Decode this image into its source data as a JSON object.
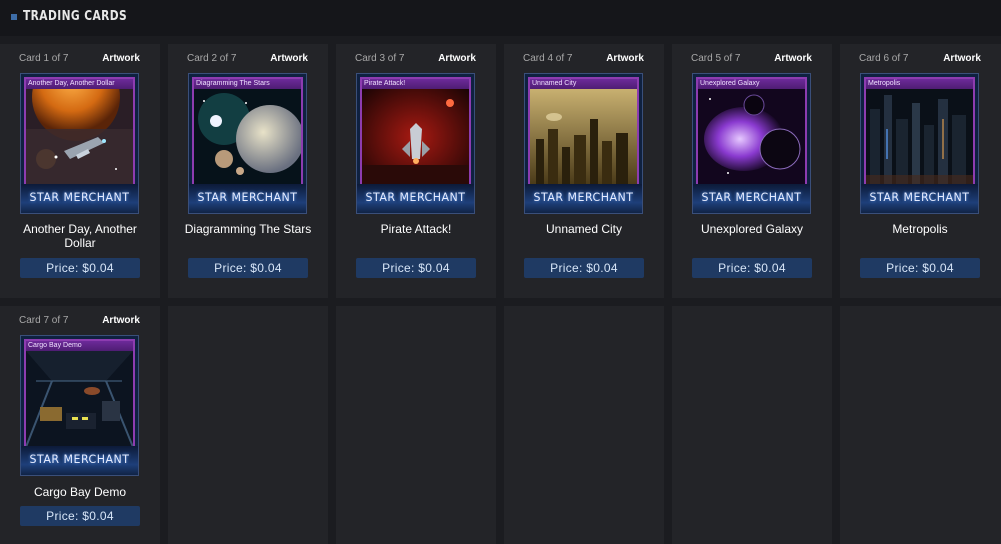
{
  "header": {
    "title": "Trading Cards"
  },
  "game_name": "STAR MERCHANT",
  "cards": [
    {
      "count": "Card 1 of 7",
      "artwork": "Artwork",
      "name": "Another Day, Another Dollar",
      "title": "Another Day, Another Dollar",
      "price": "Price: $0.04",
      "art": "planet-ship"
    },
    {
      "count": "Card 2 of 7",
      "artwork": "Artwork",
      "name": "Diagramming The Stars",
      "title": "Diagramming The Stars",
      "price": "Price: $0.04",
      "art": "planets-nebula"
    },
    {
      "count": "Card 3 of 7",
      "artwork": "Artwork",
      "name": "Pirate Attack!",
      "title": "Pirate Attack!",
      "price": "Price: $0.04",
      "art": "red-ship"
    },
    {
      "count": "Card 4 of 7",
      "artwork": "Artwork",
      "name": "Unnamed City",
      "title": "Unnamed City",
      "price": "Price: $0.04",
      "art": "golden-city"
    },
    {
      "count": "Card 5 of 7",
      "artwork": "Artwork",
      "name": "Unexplored Galaxy",
      "title": "Unexplored Galaxy",
      "price": "Price: $0.04",
      "art": "purple-galaxy"
    },
    {
      "count": "Card 6 of 7",
      "artwork": "Artwork",
      "name": "Metropolis",
      "title": "Metropolis",
      "price": "Price: $0.04",
      "art": "dark-city"
    },
    {
      "count": "Card 7 of 7",
      "artwork": "Artwork",
      "name": "Cargo Bay Demo",
      "title": "Cargo Bay Demo",
      "price": "Price: $0.04",
      "art": "cargo-bay"
    }
  ]
}
